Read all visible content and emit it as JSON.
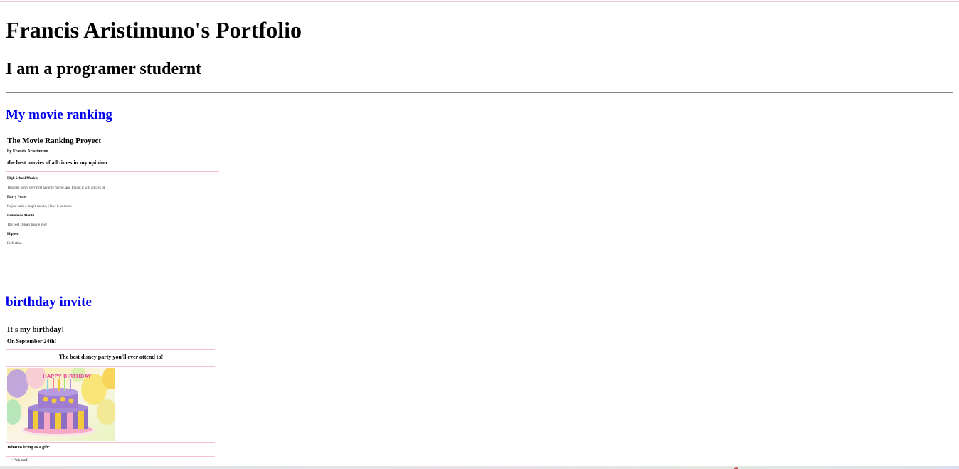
{
  "header": {
    "title": "Francis Aristimuno's Portfolio",
    "subtitle": "I am a programer studernt"
  },
  "projects": [
    {
      "link_label": "My movie ranking",
      "embed": {
        "title": "The Movie Ranking Proyect",
        "byline": "by Francis Aristimuno",
        "subtitle": "the best movies of all times in my opinion",
        "movies": [
          {
            "name": "High School Musical",
            "description": "This one is my very first favorite movie, and I think it will always be"
          },
          {
            "name": "Harry Potter",
            "description": "Its just such a magic movie, I love it so much"
          },
          {
            "name": "Lemonade Mouth",
            "description": "The best Disney movie ever"
          },
          {
            "name": "Flipped",
            "description": "Perfection"
          }
        ]
      }
    },
    {
      "link_label": "birthday invite",
      "embed": {
        "title": "It's my birthday!",
        "date": "On September 24th!",
        "tagline": "The best disney party you'll ever attend to!",
        "cake_banner": "HAPPY BIRTHDAY",
        "gift_heading": "What to bring as a gift:",
        "gift_items": [
          "Pink stuff"
        ]
      }
    }
  ],
  "colors": {
    "link": "#0000ee",
    "divider_pink": "#f4c1cd",
    "cake_purple": "#8c6fc2",
    "cake_yellow": "#f2c93b",
    "cake_pink": "#f6a9c4"
  }
}
